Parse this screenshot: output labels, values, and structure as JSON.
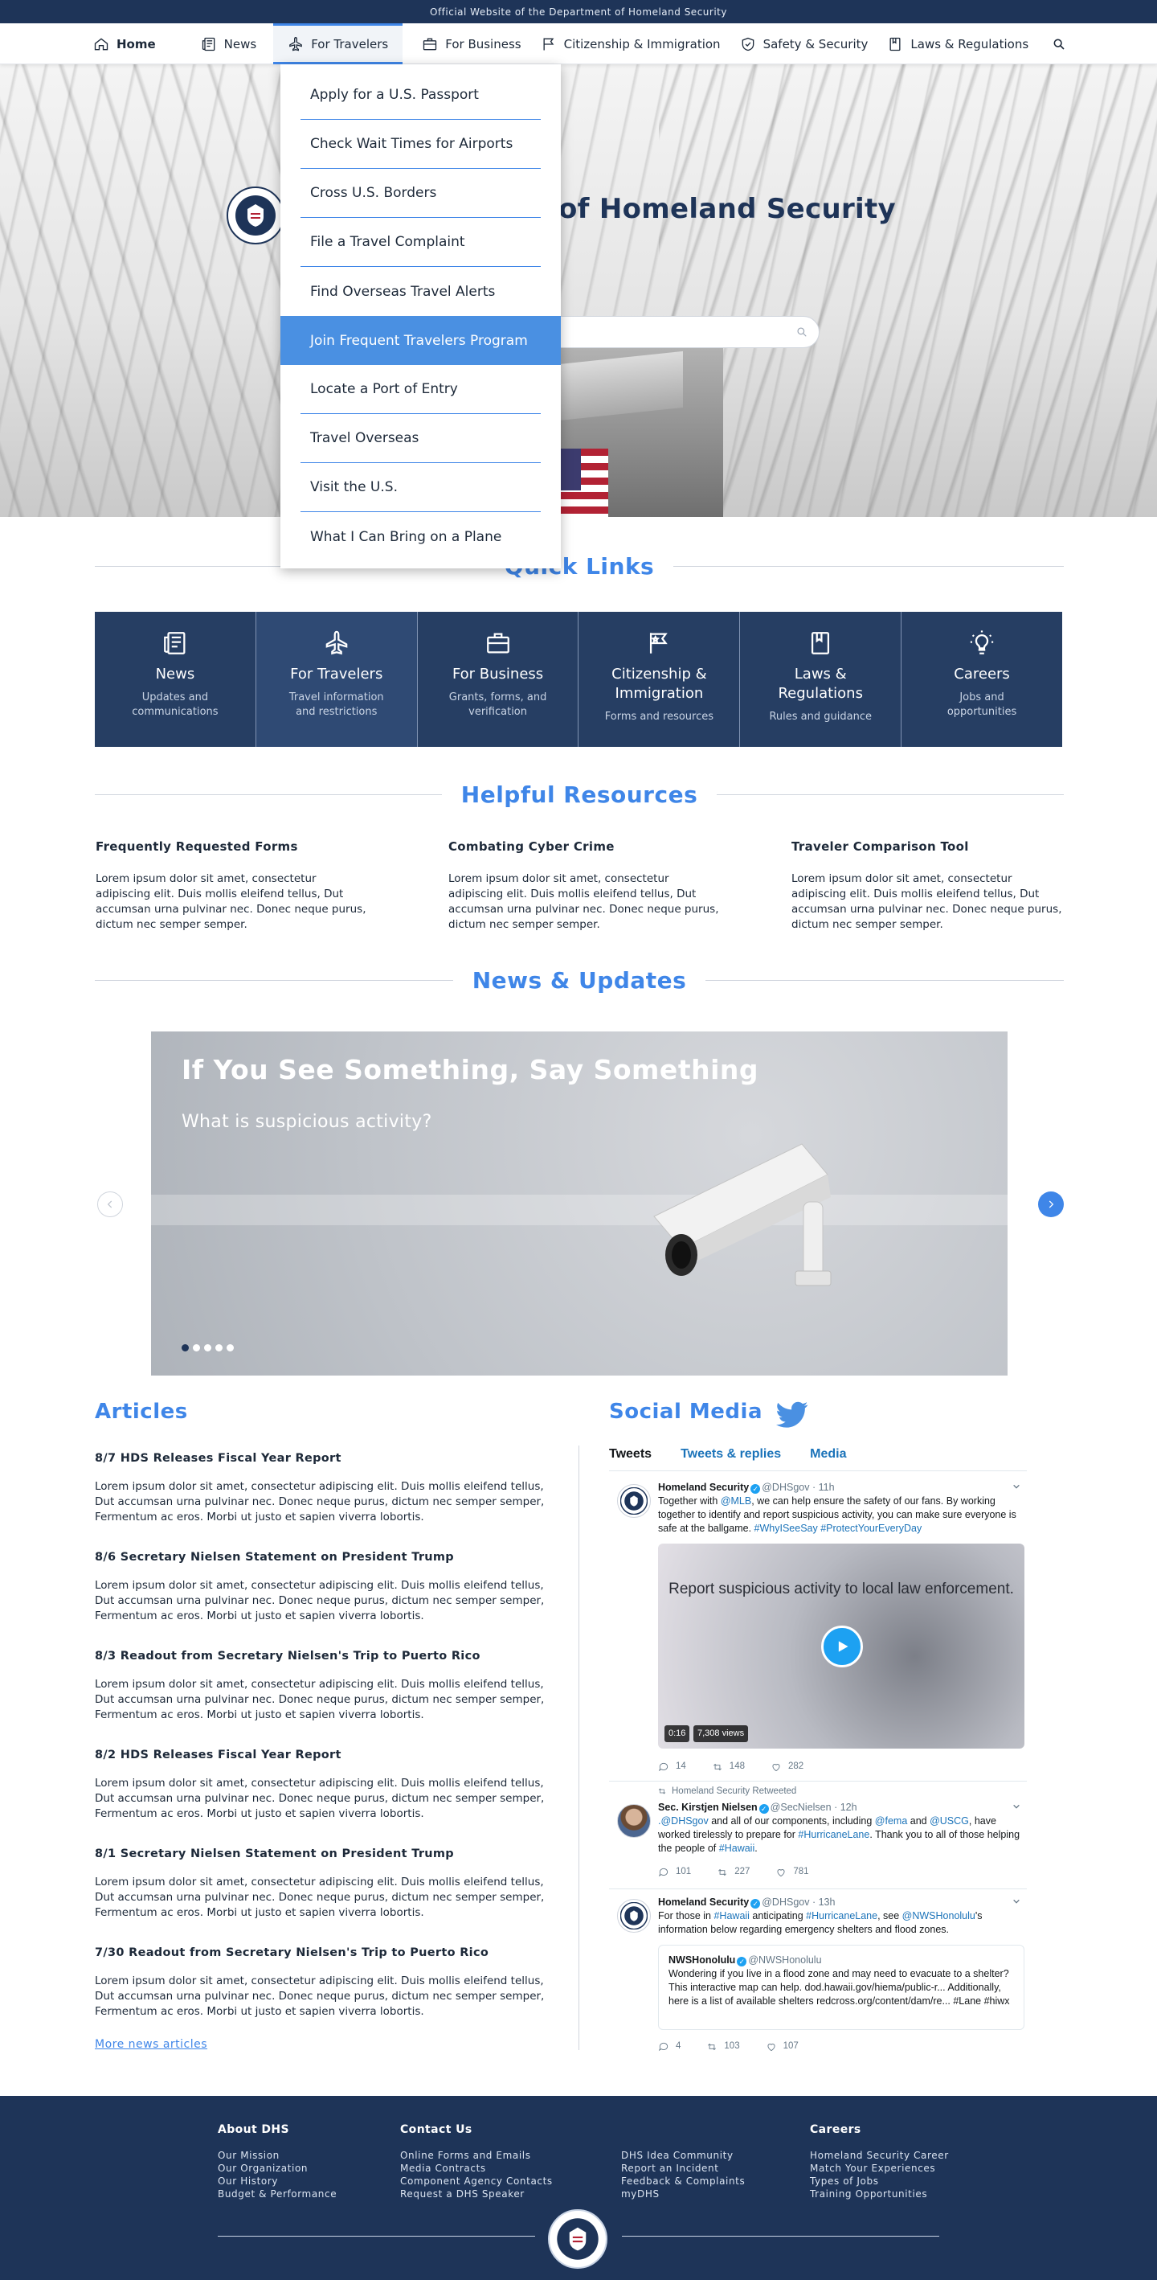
{
  "banner": {
    "text": "Official Website of the Department of Homeland Security"
  },
  "nav": {
    "items": [
      {
        "label": "Home",
        "icon": "home-icon"
      },
      {
        "label": "News",
        "icon": "newspaper-icon"
      },
      {
        "label": "For Travelers",
        "icon": "airplane-icon"
      },
      {
        "label": "For Business",
        "icon": "briefcase-icon"
      },
      {
        "label": "Citizenship & Immigration",
        "icon": "flag-icon"
      },
      {
        "label": "Safety & Security",
        "icon": "shield-icon"
      },
      {
        "label": "Laws & Regulations",
        "icon": "book-icon"
      }
    ],
    "search_icon": "search-icon",
    "active": "For Travelers"
  },
  "hero": {
    "title": "of Homeland Security"
  },
  "dropdown": {
    "items": [
      "Apply for a U.S. Passport",
      "Check Wait Times for Airports",
      "Cross U.S. Borders",
      "File a Travel Complaint",
      "Find Overseas Travel Alerts",
      "Join Frequent Travelers Program",
      "Locate a Port of Entry",
      "Travel Overseas",
      "Visit the U.S.",
      "What I Can Bring on a Plane"
    ],
    "highlighted": "Join Frequent Travelers Program"
  },
  "quick_links": {
    "title": "Quick Links",
    "cards": [
      {
        "title": "News",
        "desc": "Updates and communications",
        "icon": "newspaper-icon"
      },
      {
        "title": "For Travelers",
        "desc": "Travel information and restrictions",
        "icon": "airplane-icon"
      },
      {
        "title": "For Business",
        "desc": "Grants, forms, and verification",
        "icon": "briefcase-icon"
      },
      {
        "title": "Citizenship & Immigration",
        "desc": "Forms and resources",
        "icon": "flag-icon"
      },
      {
        "title": "Laws & Regulations",
        "desc": "Rules and guidance",
        "icon": "book-icon"
      },
      {
        "title": "Careers",
        "desc": "Jobs and opportunities",
        "icon": "lightbulb-icon"
      }
    ]
  },
  "helpful_resources": {
    "title": "Helpful Resources",
    "items": [
      {
        "title": "Frequently Requested Forms",
        "text": "Lorem ipsum dolor sit amet, consectetur adipiscing elit. Duis mollis eleifend tellus, Dut accumsan urna pulvinar nec. Donec neque purus, dictum nec semper semper."
      },
      {
        "title": "Combating Cyber Crime",
        "text": "Lorem ipsum dolor sit amet, consectetur adipiscing elit. Duis mollis eleifend tellus, Dut accumsan urna pulvinar nec. Donec neque purus, dictum nec semper semper."
      },
      {
        "title": "Traveler Comparison Tool",
        "text": "Lorem ipsum dolor sit amet, consectetur adipiscing elit. Duis mollis eleifend tellus, Dut accumsan urna pulvinar nec. Donec neque purus, dictum nec semper semper."
      }
    ]
  },
  "news_updates": {
    "title": "News & Updates",
    "slide": {
      "title": "If You See Something, Say Something",
      "subtitle": "What is suspicious activity?"
    },
    "slide_count": 5,
    "active_slide": 1
  },
  "articles": {
    "title": "Articles",
    "items": [
      {
        "title": "8/7 HDS Releases Fiscal Year Report",
        "text": "Lorem ipsum dolor sit amet, consectetur adipiscing elit. Duis mollis eleifend tellus, Dut accumsan urna pulvinar nec. Donec neque purus, dictum nec semper semper, Fermentum ac eros. Morbi ut justo et sapien viverra lobortis."
      },
      {
        "title": "8/6 Secretary Nielsen Statement on President Trump",
        "text": "Lorem ipsum dolor sit amet, consectetur adipiscing elit. Duis mollis eleifend tellus, Dut accumsan urna pulvinar nec. Donec neque purus, dictum nec semper semper, Fermentum ac eros. Morbi ut justo et sapien viverra lobortis."
      },
      {
        "title": "8/3 Readout from Secretary Nielsen's Trip to Puerto Rico",
        "text": "Lorem ipsum dolor sit amet, consectetur adipiscing elit. Duis mollis eleifend tellus, Dut accumsan urna pulvinar nec. Donec neque purus, dictum nec semper semper, Fermentum ac eros. Morbi ut justo et sapien viverra lobortis."
      },
      {
        "title": "8/2 HDS Releases Fiscal Year Report",
        "text": "Lorem ipsum dolor sit amet, consectetur adipiscing elit. Duis mollis eleifend tellus, Dut accumsan urna pulvinar nec. Donec neque purus, dictum nec semper semper, Fermentum ac eros. Morbi ut justo et sapien viverra lobortis."
      },
      {
        "title": "8/1 Secretary Nielsen Statement on President Trump",
        "text": "Lorem ipsum dolor sit amet, consectetur adipiscing elit. Duis mollis eleifend tellus, Dut accumsan urna pulvinar nec. Donec neque purus, dictum nec semper semper, Fermentum ac eros. Morbi ut justo et sapien viverra lobortis."
      },
      {
        "title": "7/30 Readout from Secretary Nielsen's Trip to Puerto Rico",
        "text": "Lorem ipsum dolor sit amet, consectetur adipiscing elit. Duis mollis eleifend tellus, Dut accumsan urna pulvinar nec. Donec neque purus, dictum nec semper semper, Fermentum ac eros. Morbi ut justo et sapien viverra lobortis."
      }
    ],
    "more_link": "More news articles"
  },
  "social": {
    "title": "Social Media",
    "tabs": [
      "Tweets",
      "Tweets & replies",
      "Media"
    ],
    "tweets": [
      {
        "name": "Homeland Security",
        "handle": "@DHSgov",
        "time": "11h",
        "text_parts": [
          "Together with ",
          "@MLB",
          ", we can help ensure the safety of our fans. By working together to identify and report suspicious activity, you can make sure everyone is safe at the ballgame. ",
          "#WhyISeeSay #ProtectYourEveryDay"
        ],
        "media_text": "Report suspicious activity to local law enforcement.",
        "media_duration": "0:16",
        "media_views": "7,308 views",
        "replies": "14",
        "retweets": "148",
        "likes": "282"
      },
      {
        "retweet_note": "Homeland Security Retweeted",
        "name": "Sec. Kirstjen Nielsen",
        "handle": "@SecNielsen",
        "time": "12h",
        "text_parts": [
          ".@DHSgov",
          " and all of our components, including ",
          "@fema",
          " and ",
          "@USCG",
          ", have worked tirelessly to prepare for ",
          "#HurricaneLane",
          ". Thank you to all of those helping the people of ",
          "#Hawaii",
          "."
        ],
        "replies": "101",
        "retweets": "227",
        "likes": "781"
      },
      {
        "name": "Homeland Security",
        "handle": "@DHSgov",
        "time": "13h",
        "text_parts": [
          "For those in ",
          "#Hawaii",
          " anticipating ",
          "#HurricaneLane",
          ", see ",
          "@NWSHonolulu",
          "'s information below regarding emergency shelters and flood zones."
        ],
        "quote": {
          "name": "NWSHonolulu",
          "handle": "@NWSHonolulu",
          "text": "Wondering if you live in a flood zone and may need to evacuate to a shelter? This interactive map can help. dod.hawaii.gov/hiema/public-r... Additionally, here is a list of available shelters redcross.org/content/dam/re... #Lane #hiwx"
        },
        "replies": "4",
        "retweets": "103",
        "likes": "107"
      }
    ]
  },
  "footer": {
    "columns": [
      {
        "title": "About DHS",
        "links": [
          "Our Mission",
          "Our Organization",
          "Our History",
          "Budget & Performance"
        ]
      },
      {
        "title": "Contact Us",
        "links": [
          "Online Forms and Emails",
          "Media Contracts",
          "Component Agency Contacts",
          "Request a DHS Speaker"
        ]
      },
      {
        "title": "",
        "links": [
          "DHS Idea Community",
          "Report an Incident",
          "Feedback & Complaints",
          "myDHS"
        ]
      },
      {
        "title": "Careers",
        "links": [
          "Homeland Security Career",
          "Match Your Experiences",
          "Types of Jobs",
          "Training Opportunities"
        ]
      }
    ]
  },
  "colors": {
    "navy": "#1e3458",
    "accent_blue": "#3f86e8",
    "card_bg": "#263e63",
    "highlight": "#4a90e2"
  }
}
